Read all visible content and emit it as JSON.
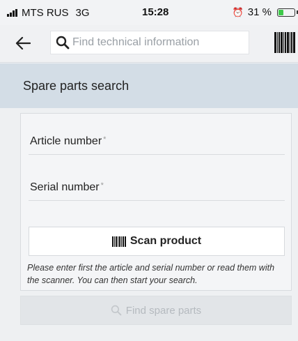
{
  "status_bar": {
    "carrier": "MTS RUS",
    "network": "3G",
    "time": "15:28",
    "battery_percent_label": "31 %",
    "battery_level": 0.31
  },
  "header": {
    "search_placeholder": "Find technical information",
    "back_icon": "arrow-left-icon",
    "barcode_icon": "barcode-icon"
  },
  "page": {
    "title": "Spare parts search"
  },
  "form": {
    "article_label": "Article number",
    "serial_label": "Serial number",
    "required_marker": "*",
    "scan_label": "Scan product",
    "hint": "Please enter first the article and serial number or read them with the scanner. You can then start your search."
  },
  "actions": {
    "find_label": "Find spare parts"
  },
  "colors": {
    "title_bar_bg": "#d3dde6",
    "battery_green": "#3ec94a",
    "disabled_text": "#b5babf"
  }
}
